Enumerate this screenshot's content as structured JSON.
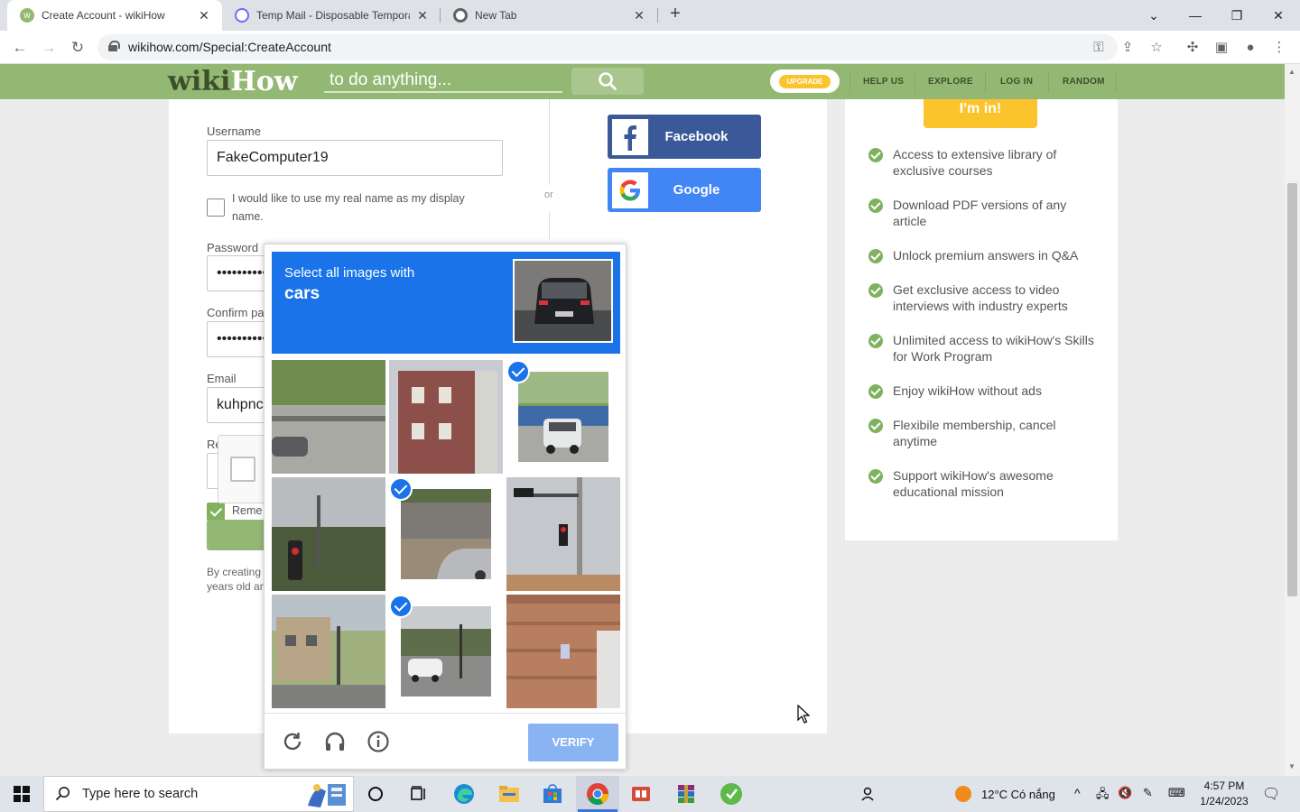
{
  "browser": {
    "tabs": [
      {
        "title": "Create Account - wikiHow",
        "active": true
      },
      {
        "title": "Temp Mail - Disposable Tempora",
        "active": false
      },
      {
        "title": "New Tab",
        "active": false
      }
    ],
    "new_tab_label": "+",
    "url": "wikihow.com/Special:CreateAccount"
  },
  "wikihow_header": {
    "logo_wiki": "wiki",
    "logo_how": "How",
    "search_placeholder": "to do anything...",
    "upgrade_label": "UPGRADE",
    "nav": [
      "HELP US",
      "EXPLORE",
      "LOG IN",
      "RANDOM"
    ]
  },
  "form": {
    "username_label": "Username",
    "username_value": "FakeComputer19",
    "realname_checkbox_text": "I would like to use my real name as my display name.",
    "password_label": "Password",
    "password_value": "••••••••••",
    "confirm_label": "Confirm pa",
    "confirm_value": "••••••••••",
    "email_label": "Email",
    "email_value": "kuhpnc",
    "realname_label": "Real name",
    "remember_text": "Reme",
    "note_line1": "By creating a",
    "note_line2": "years old an",
    "or_text": "or"
  },
  "social": {
    "facebook_label": "Facebook",
    "google_label": "Google"
  },
  "benefits": {
    "im_in_label": "I'm in!",
    "items": [
      "Access to extensive library of exclusive courses",
      "Download PDF versions of any article",
      "Unlock premium answers in Q&A",
      "Get exclusive access to video interviews with industry experts",
      "Unlimited access to wikiHow's Skills for Work Program",
      "Enjoy wikiHow without ads",
      "Flexibile membership, cancel anytime",
      "Support wikiHow's awesome educational mission"
    ]
  },
  "captcha": {
    "instruction": "Select all images with",
    "target": "cars",
    "verify_label": "VERIFY",
    "selected_tiles": [
      2,
      4,
      7
    ],
    "colors": {
      "header": "#1a73e8",
      "verify": "#8ab3f2"
    }
  },
  "taskbar": {
    "search_placeholder": "Type here to search",
    "weather": "12°C  Có nắng",
    "time": "4:57 PM",
    "date": "1/24/2023"
  },
  "colors": {
    "wikihow_green": "#93b874",
    "wikihow_dark": "#3d4f2a",
    "yellow": "#fcc42c",
    "facebook": "#3b5998",
    "google": "#4285f4"
  }
}
